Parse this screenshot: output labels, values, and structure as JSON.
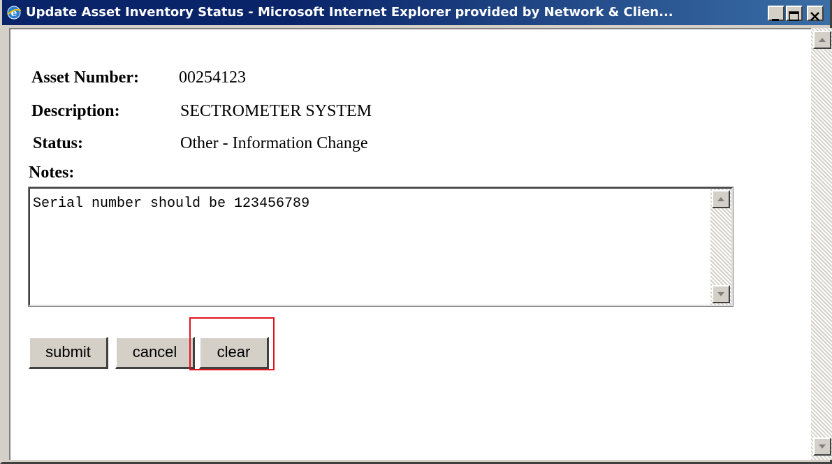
{
  "window": {
    "title": "Update Asset Inventory Status - Microsoft Internet Explorer provided by Network & Clien..."
  },
  "form": {
    "asset_number_label": "Asset Number:",
    "asset_number_value": "00254123",
    "description_label": "Description:",
    "description_value": "SECTROMETER SYSTEM",
    "status_label": "Status:",
    "status_value": "Other - Information Change",
    "notes_label": "Notes:",
    "notes_value": "Serial number should be 123456789"
  },
  "buttons": {
    "submit": "submit",
    "cancel": "cancel",
    "clear": "clear"
  },
  "colors": {
    "title_bar_start": "#0a246a",
    "title_bar_end": "#3a6ea5",
    "highlight": "#e0141e",
    "face": "#d4d0c8"
  },
  "icons": {
    "title": "internet-explorer-icon",
    "minimize": "minimize-icon",
    "maximize": "maximize-icon",
    "close": "close-icon",
    "scroll_up": "arrow-up-icon",
    "scroll_down": "arrow-down-icon"
  }
}
